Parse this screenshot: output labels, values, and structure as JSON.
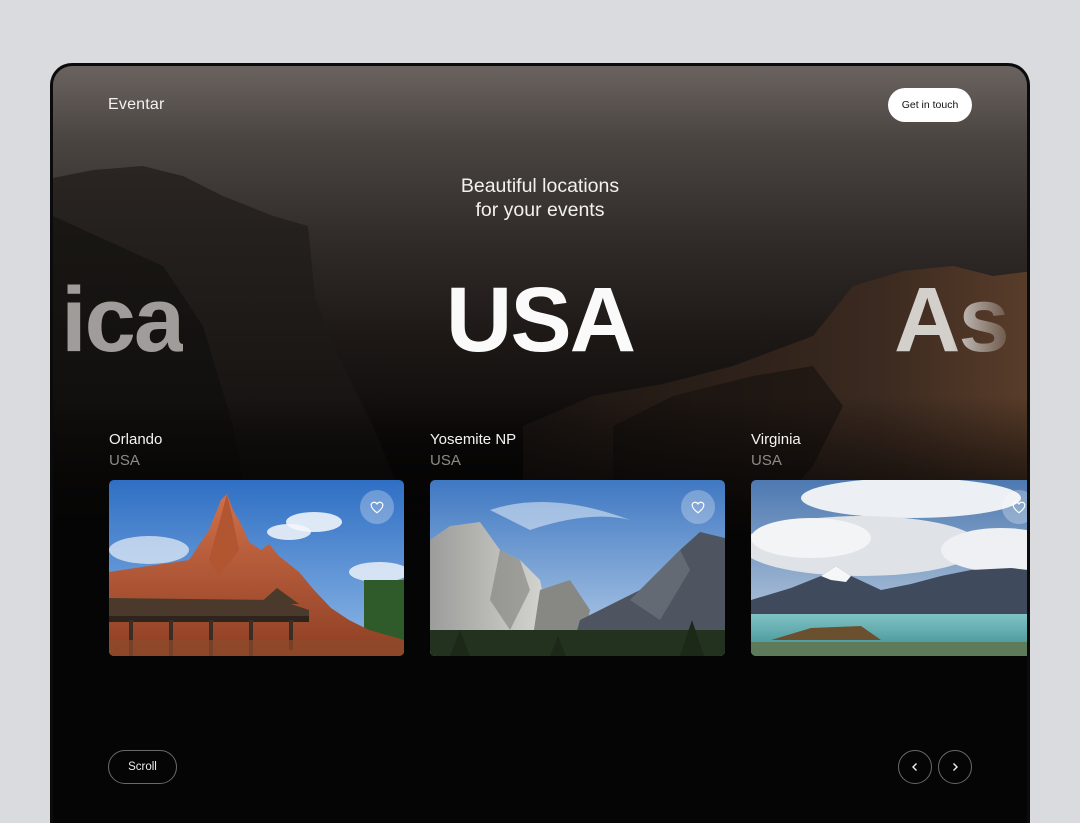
{
  "brand": {
    "logo": "Eventar"
  },
  "header": {
    "cta_label": "Get in touch"
  },
  "hero": {
    "tagline_line1": "Beautiful locations",
    "tagline_line2": "for your events",
    "region_current": "USA",
    "region_prev_partial": "ica",
    "region_next_partial": "As"
  },
  "cards": [
    {
      "name": "Orlando",
      "country": "USA",
      "icon": "heart-icon"
    },
    {
      "name": "Yosemite NP",
      "country": "USA",
      "icon": "heart-icon"
    },
    {
      "name": "Virginia",
      "country": "USA",
      "icon": "heart-icon"
    }
  ],
  "footer": {
    "scroll_label": "Scroll",
    "prev_icon": "chevron-left-icon",
    "next_icon": "chevron-right-icon"
  },
  "colors": {
    "background": "#060505",
    "text": "#f6f4f2",
    "muted": "#8e8a87",
    "button_bg": "#ffffff"
  }
}
